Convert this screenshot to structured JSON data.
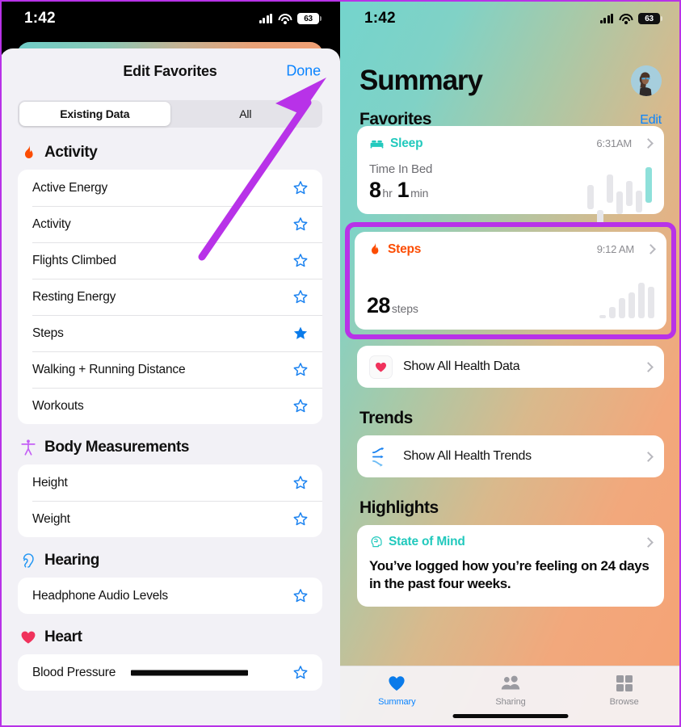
{
  "annotation": {
    "arrow_color": "#b832e8",
    "highlight_color": "#b832e8",
    "arrow_points_to": "Done",
    "highlight_target": "Steps card"
  },
  "left_phone": {
    "status_bar": {
      "time": "1:42",
      "battery": "63",
      "signal_icon": "cellular-signal-icon",
      "wifi_icon": "wifi-icon",
      "battery_icon": "battery-icon"
    },
    "sheet": {
      "title": "Edit Favorites",
      "done_label": "Done",
      "segmented": {
        "options": [
          "Existing Data",
          "All"
        ],
        "selected": "Existing Data"
      },
      "categories": [
        {
          "name": "Activity",
          "icon": "flame-icon",
          "icon_color": "#fc4c02",
          "items": [
            {
              "label": "Active Energy",
              "favorite": false
            },
            {
              "label": "Activity",
              "favorite": false
            },
            {
              "label": "Flights Climbed",
              "favorite": false
            },
            {
              "label": "Resting Energy",
              "favorite": false
            },
            {
              "label": "Steps",
              "favorite": true
            },
            {
              "label": "Walking + Running Distance",
              "favorite": false
            },
            {
              "label": "Workouts",
              "favorite": false
            }
          ]
        },
        {
          "name": "Body Measurements",
          "icon": "body-figure-icon",
          "icon_color": "#c45ff5",
          "items": [
            {
              "label": "Height",
              "favorite": false
            },
            {
              "label": "Weight",
              "favorite": false
            }
          ]
        },
        {
          "name": "Hearing",
          "icon": "ear-icon",
          "icon_color": "#2196f3",
          "items": [
            {
              "label": "Headphone Audio Levels",
              "favorite": false
            }
          ]
        },
        {
          "name": "Heart",
          "icon": "heart-icon",
          "icon_color": "#f0325c",
          "items": [
            {
              "label": "Blood Pressure",
              "favorite": false,
              "redacted": true
            }
          ]
        }
      ]
    }
  },
  "right_phone": {
    "status_bar": {
      "time": "1:42",
      "battery": "63"
    },
    "page_title": "Summary",
    "favorites": {
      "section_title": "Favorites",
      "edit_label": "Edit",
      "cards": [
        {
          "title": "Sleep",
          "title_color": "#22c9bd",
          "icon": "bed-icon",
          "time": "6:31AM",
          "metric_label": "Time In Bed",
          "value_primary": "8",
          "unit_primary": "hr",
          "value_secondary": "1",
          "unit_secondary": "min",
          "chart": {
            "type": "bar",
            "values": [
              62,
              38,
              72,
              58,
              64,
              56,
              90
            ],
            "accent_index": 6,
            "offsets": [
              8,
              28,
              0,
              14,
              4,
              12,
              0
            ]
          }
        },
        {
          "title": "Steps",
          "title_color": "#fc4c02",
          "icon": "flame-icon",
          "time": "9:12 AM",
          "value_primary": "28",
          "unit_primary": "steps",
          "highlighted": true,
          "chart": {
            "type": "bar",
            "values": [
              8,
              30,
              52,
              66,
              92,
              82
            ],
            "offsets": [
              0,
              0,
              0,
              0,
              0,
              0
            ]
          }
        }
      ],
      "show_all": {
        "label": "Show All Health Data",
        "icon": "heart-icon"
      }
    },
    "trends": {
      "section_title": "Trends",
      "show_all": {
        "label": "Show All Health Trends",
        "icon": "trends-arrows-icon"
      }
    },
    "highlights": {
      "section_title": "Highlights",
      "card": {
        "title": "State of Mind",
        "title_color": "#22c9bd",
        "icon": "brain-head-icon",
        "text": "You’ve logged how you’re feeling on 24 days in the past four weeks."
      }
    },
    "tabs": [
      {
        "label": "Summary",
        "icon": "heart-icon",
        "active": true
      },
      {
        "label": "Sharing",
        "icon": "people-icon",
        "active": false
      },
      {
        "label": "Browse",
        "icon": "grid-icon",
        "active": false
      }
    ]
  }
}
